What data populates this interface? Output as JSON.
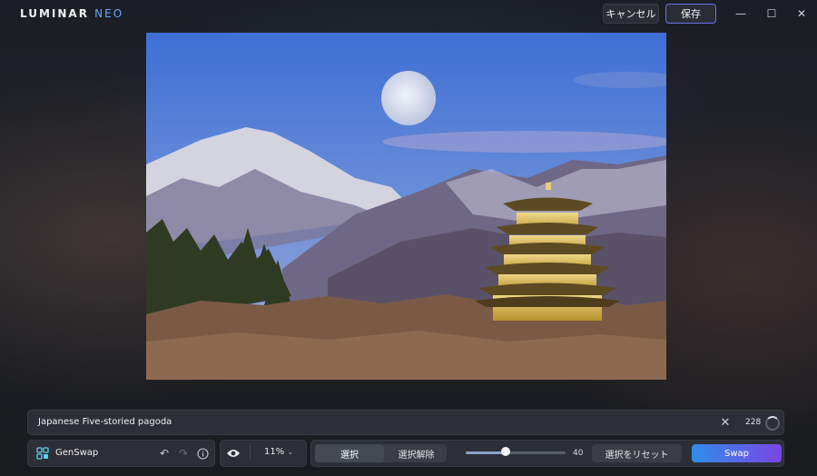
{
  "app": {
    "logo_main": "LUMINAR",
    "logo_accent": "NEO"
  },
  "header": {
    "cancel_label": "キャンセル",
    "save_label": "保存"
  },
  "window": {
    "minimize": "—",
    "maximize": "☐",
    "close": "✕"
  },
  "prompt": {
    "value": "Japanese Five-storied pagoda",
    "count": "228",
    "clear_icon": "close-icon"
  },
  "toolbar": {
    "genswap_label": "GenSwap",
    "undo_icon": "undo-icon",
    "redo_icon": "redo-icon",
    "info_icon": "info-icon",
    "eye_icon": "eye-icon",
    "zoom": "11%",
    "select_label": "選択",
    "deselect_label": "選択解除",
    "brush_size": 40,
    "brush_size_label": "40",
    "brush_max": 100,
    "reset_label": "選択をリセット",
    "swap_label": "Swap"
  },
  "colors": {
    "accent_outline": "#6b6df0",
    "swap_gradient_start": "#2f8ee8",
    "swap_gradient_end": "#7a45e6",
    "logo_accent": "#6aa7ff"
  }
}
